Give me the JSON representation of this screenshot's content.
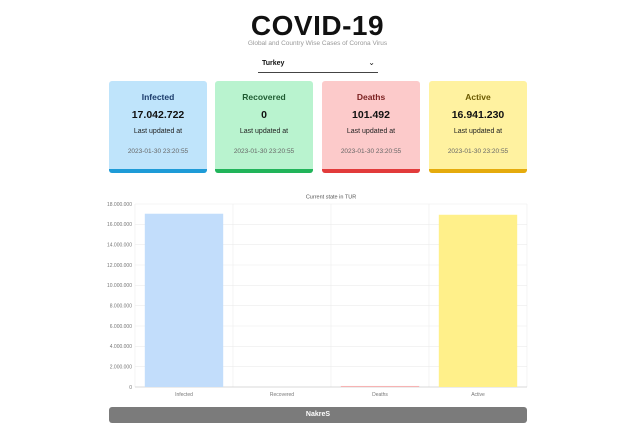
{
  "header": {
    "title": "COVID-19",
    "subtitle": "Global and Country Wise Cases of Corona Virus"
  },
  "country_select": {
    "selected": "Turkey",
    "chevron_icon": "chevron-down-icon"
  },
  "cards": {
    "infected": {
      "title": "Infected",
      "value": "17.042.722",
      "updated_label": "Last updated at",
      "timestamp": "2023-01-30 23:20:55",
      "color": "#bfe4fb",
      "accent": "#1e9bd7"
    },
    "recovered": {
      "title": "Recovered",
      "value": "0",
      "updated_label": "Last updated at",
      "timestamp": "2023-01-30 23:20:55",
      "color": "#b9f3cf",
      "accent": "#21b45a"
    },
    "deaths": {
      "title": "Deaths",
      "value": "101.492",
      "updated_label": "Last updated at",
      "timestamp": "2023-01-30 23:20:55",
      "color": "#fccaca",
      "accent": "#e23b3b"
    },
    "active": {
      "title": "Active",
      "value": "16.941.230",
      "updated_label": "Last updated at",
      "timestamp": "2023-01-30 23:20:55",
      "color": "#fff2a0",
      "accent": "#e5ab0d"
    }
  },
  "chart_data": {
    "type": "bar",
    "title": "Current state in TUR",
    "categories": [
      "Infected",
      "Recovered",
      "Deaths",
      "Active"
    ],
    "values": [
      17042722,
      0,
      101492,
      16941230
    ],
    "colors": [
      "#c2ddfb",
      "#b9f3cf",
      "#f6b3b3",
      "#fff08a"
    ],
    "ylim": [
      0,
      18000000
    ],
    "yticks": [
      0,
      2000000,
      4000000,
      6000000,
      8000000,
      10000000,
      12000000,
      14000000,
      16000000,
      18000000
    ],
    "ytick_labels": [
      "0",
      "2.000.000",
      "4.000.000",
      "6.000.000",
      "8.000.000",
      "10.000.000",
      "12.000.000",
      "14.000.000",
      "16.000.000",
      "18.000.000"
    ],
    "grid": true,
    "xlabel": "",
    "ylabel": ""
  },
  "footer": {
    "label": "NakreS"
  }
}
